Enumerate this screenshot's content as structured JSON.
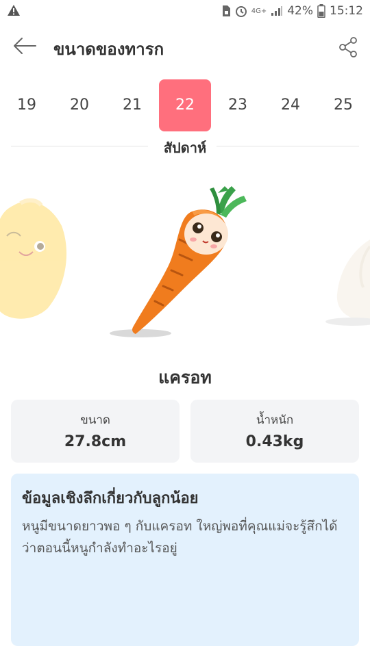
{
  "status": {
    "battery": "42%",
    "time": "15:12",
    "network": "4G+"
  },
  "header": {
    "title": "ขนาดของทารก"
  },
  "weeks": {
    "items": [
      "19",
      "20",
      "21",
      "22",
      "23",
      "24",
      "25"
    ],
    "selected": "22",
    "label": "สัปดาห์"
  },
  "fruit": {
    "name": "แครอท",
    "size_label": "ขนาด",
    "size_value": "27.8cm",
    "weight_label": "น้ำหนัก",
    "weight_value": "0.43kg"
  },
  "info": {
    "title": "ข้อมูลเชิงลึกเกี่ยวกับลูกน้อย",
    "body": "หนูมีขนาดยาวพอ ๆ กับแครอท ใหญ่พอที่คุณแม่จะรู้สึกได้ว่าตอนนี้หนูกำลังทำอะไรอยู่"
  },
  "colors": {
    "accent": "#ff6f7d",
    "info_bg": "#e3f1fd",
    "card_bg": "#f3f4f6"
  }
}
